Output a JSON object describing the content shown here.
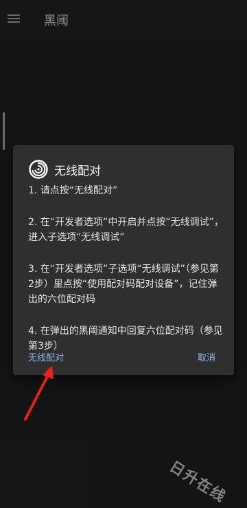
{
  "app": {
    "title": "黑阈",
    "menu_icon": "hamburger-menu-icon"
  },
  "dialog": {
    "icon": "swirl-logo-icon",
    "title": "无线配对",
    "steps": [
      "1. 请点按“无线配对”",
      "2. 在“开发者选项”中开启并点按“无线调试”，进入子选项“无线调试”",
      "3. 在“开发者选项”子选项“无线调试”（参见第2步）里点按“使用配对码配对设备”，记住弹出的六位配对码",
      "4. 在弹出的黑阈通知中回复六位配对码（参见第3步）"
    ],
    "buttons": {
      "positive": "无线配对",
      "negative": "取消"
    },
    "accent_color": "#8fb5e8"
  },
  "annotation": {
    "arrow_color": "#e5221c"
  },
  "watermark": "日升在线"
}
